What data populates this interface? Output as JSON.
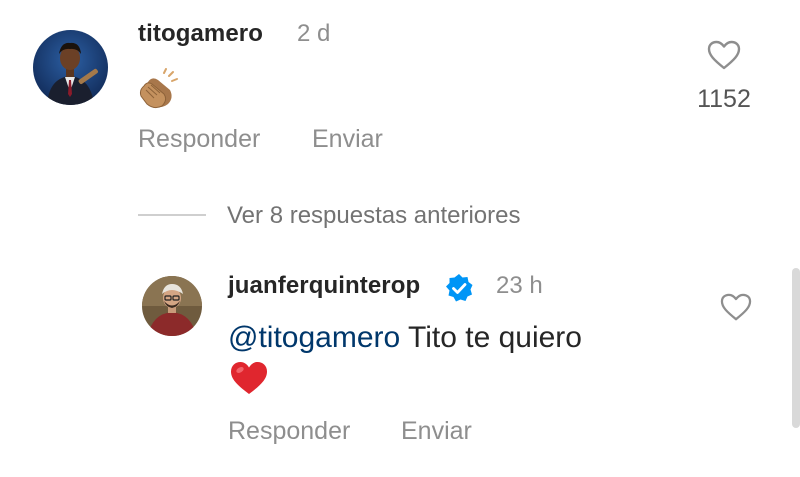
{
  "comment": {
    "username": "titogamero",
    "time": "2 d",
    "emoji": "clapping-hands",
    "like_count": "1152",
    "reply_label": "Responder",
    "send_label": "Enviar"
  },
  "view_replies": {
    "label": "Ver 8 respuestas anteriores"
  },
  "reply": {
    "username": "juanferquinterop",
    "verified": true,
    "time": "23 h",
    "mention": "@titogamero",
    "text": " Tito te quiero",
    "emoji": "red-heart",
    "reply_label": "Responder",
    "send_label": "Enviar"
  },
  "colors": {
    "verified_badge": "#0095f6",
    "mention": "#00376b",
    "heart_emoji": "#e0262e",
    "skin_tone": "#b98659"
  }
}
